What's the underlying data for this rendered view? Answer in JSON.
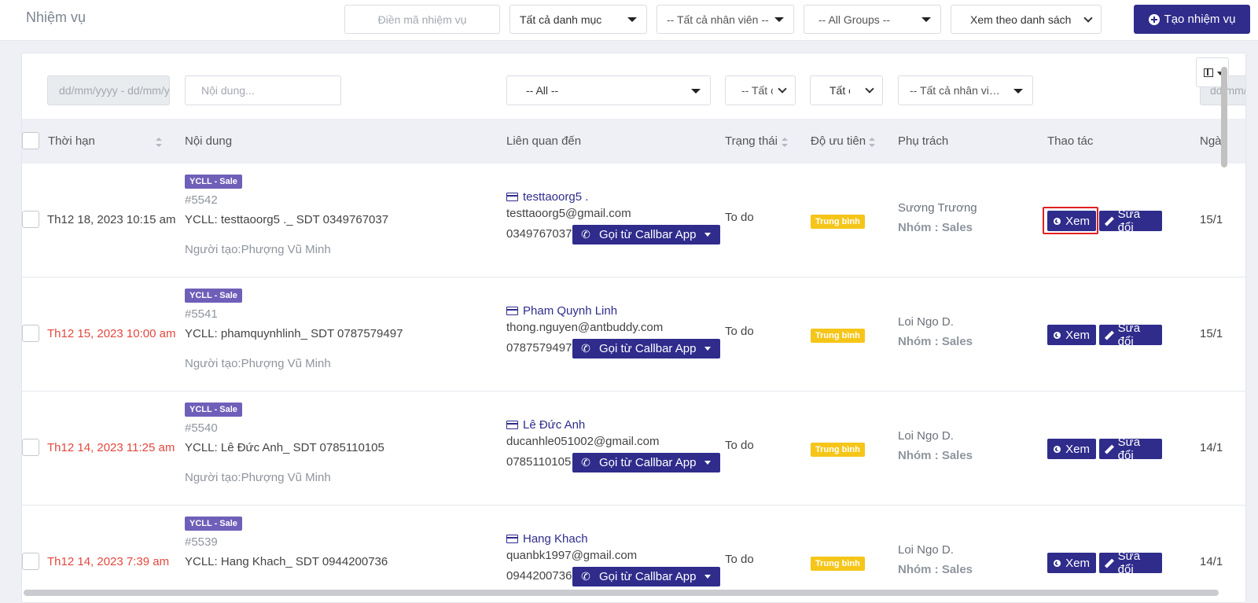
{
  "header": {
    "title": "Nhiệm vụ",
    "task_code_placeholder": "Điền mã nhiệm vụ",
    "category_select": "Tất cả danh mục",
    "staff_select": "-- Tất cả nhân viên --",
    "groups_select": "-- All Groups --",
    "view_select": "Xem theo danh sách",
    "create_button": "Tạo nhiệm vụ"
  },
  "filters": {
    "date_placeholder": "dd/mm/yyyy - dd/mm/yyyy",
    "content_placeholder": "Nội dung...",
    "related_select": "-- All --",
    "status_select": "-- Tất cả --",
    "priority_select": "Tất cả",
    "owner_select": "-- Tất cả nhân viên --",
    "extra_date_placeholder": "dd/mm/yyyy"
  },
  "table": {
    "columns": {
      "due": "Thời hạn",
      "content": "Nội dung",
      "related": "Liên quan đến",
      "status": "Trạng thái",
      "priority": "Độ ưu tiên",
      "owner": "Phụ trách",
      "actions": "Thao tác",
      "date": "Ngày"
    },
    "rows": [
      {
        "due": "Th12 18, 2023 10:15 am",
        "overdue": false,
        "tag": "YCLL - Sale",
        "id": "#5542",
        "content": "YCLL: testtaoorg5 ._ SDT 0349767037",
        "creator": "Người tạo:Phượng Vũ Minh",
        "contact_name": "testtaoorg5 .",
        "email": "testtaoorg5@gmail.com",
        "phone": "0349767037",
        "call_label": "Gọi từ Callbar App",
        "status": "To do",
        "priority": "Trung bình",
        "owner": "Sương Trương",
        "group": "Nhóm : Sales",
        "view_label": "Xem",
        "edit_label": "Sửa đổi",
        "date": "15/1"
      },
      {
        "due": "Th12 15, 2023 10:00 am",
        "overdue": true,
        "tag": "YCLL - Sale",
        "id": "#5541",
        "content": "YCLL: phamquynhlinh_ SDT 0787579497",
        "creator": "Người tạo:Phượng Vũ Minh",
        "contact_name": "Pham Quynh Linh",
        "email": "thong.nguyen@antbuddy.com",
        "phone": "0787579497",
        "call_label": "Gọi từ Callbar App",
        "status": "To do",
        "priority": "Trung bình",
        "owner": "Loi Ngo D.",
        "group": "Nhóm : Sales",
        "view_label": "Xem",
        "edit_label": "Sửa đổi",
        "date": "15/1"
      },
      {
        "due": "Th12 14, 2023 11:25 am",
        "overdue": true,
        "tag": "YCLL - Sale",
        "id": "#5540",
        "content": "YCLL: Lê Đức Anh_ SDT 0785110105",
        "creator": "Người tạo:Phượng Vũ Minh",
        "contact_name": "Lê Đức Anh",
        "email": "ducanhle051002@gmail.com",
        "phone": "0785110105",
        "call_label": "Gọi từ Callbar App",
        "status": "To do",
        "priority": "Trung bình",
        "owner": "Loi Ngo D.",
        "group": "Nhóm : Sales",
        "view_label": "Xem",
        "edit_label": "Sửa đổi",
        "date": "14/1"
      },
      {
        "due": "Th12 14, 2023 7:39 am",
        "overdue": true,
        "tag": "YCLL - Sale",
        "id": "#5539",
        "content": "YCLL: Hang Khach_ SDT 0944200736",
        "creator": "",
        "contact_name": "Hang Khach",
        "email": "quanbk1997@gmail.com",
        "phone": "0944200736",
        "call_label": "Gọi từ Callbar App",
        "status": "To do",
        "priority": "Trung bình",
        "owner": "Loi Ngo D.",
        "group": "Nhóm : Sales",
        "view_label": "Xem",
        "edit_label": "Sửa đổi",
        "date": "14/1"
      }
    ]
  },
  "colors": {
    "brand": "#2f2c8c",
    "tag": "#6f5fb8",
    "priority_medium": "#f5c518",
    "overdue": "#e2483d",
    "highlight": "#e02020"
  }
}
